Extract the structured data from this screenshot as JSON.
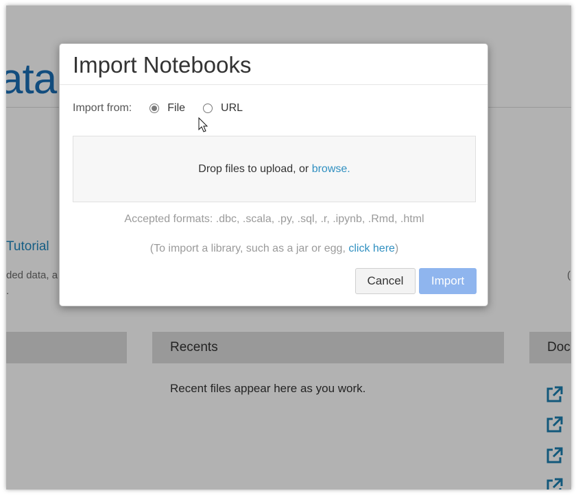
{
  "background": {
    "logo_fragment": "ata",
    "tutorial_link": "Tutorial",
    "tutorial_desc_line1": "ded data, a",
    "tutorial_desc_line2": ".",
    "right_fragment": "(",
    "panels": {
      "left_label": "",
      "recents_title": "Recents",
      "recents_empty": "Recent files appear here as you work.",
      "docs_title": "Doc"
    }
  },
  "modal": {
    "title": "Import Notebooks",
    "import_from_label": "Import from:",
    "options": [
      {
        "label": "File",
        "selected": true
      },
      {
        "label": "URL",
        "selected": false
      }
    ],
    "dropzone_text": "Drop files to upload, or ",
    "dropzone_link": "browse.",
    "accepted_formats": "Accepted formats: .dbc, .scala, .py, .sql, .r, .ipynb, .Rmd, .html",
    "library_prefix": "(To import a library, such as a jar or egg, ",
    "library_link": "click here",
    "library_suffix": ")",
    "cancel_label": "Cancel",
    "import_label": "Import"
  },
  "colors": {
    "accent_link": "#2f8fc0",
    "import_button_disabled": "#8fb5ee",
    "logo_blue": "#1b6fb5"
  },
  "icons": {
    "external_link": "external-link-icon",
    "cursor": "mouse-pointer-icon"
  }
}
